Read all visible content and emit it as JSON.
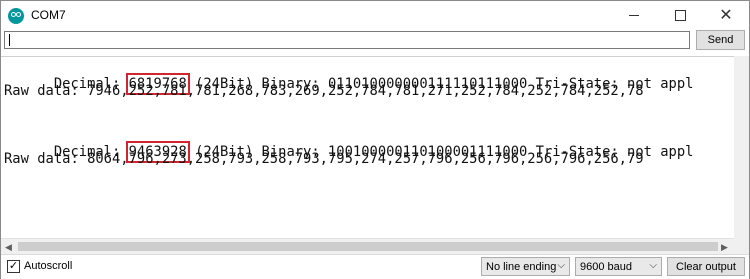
{
  "window": {
    "title": "COM7",
    "controls": {
      "minimize": "minimize",
      "maximize": "maximize",
      "close": "close"
    }
  },
  "input_row": {
    "value": "",
    "send_label": "Send"
  },
  "output": {
    "lines": [
      {
        "prefix": "Decimal: ",
        "highlight": "6819768",
        "rest": " (24Bit) Binary: 011010000000111110111000 Tri-State: not appl"
      },
      {
        "text": "Raw data: 7946,252,781,781,268,783,269,252,784,781,271,252,784,252,784,252,78"
      },
      {
        "text": ""
      },
      {
        "prefix": "Decimal: ",
        "highlight": "9463928",
        "rest": " (24Bit) Binary: 100100000110100001111000 Tri-State: not appl"
      },
      {
        "text": "Raw data: 8064,796,273,258,793,258,793,795,274,257,796,256,796,256,796,256,79"
      }
    ],
    "highlight_color": "#d0262d"
  },
  "bottom_bar": {
    "autoscroll_label": "Autoscroll",
    "autoscroll_checked": true,
    "line_ending": "No line ending",
    "baud": "9600 baud",
    "clear_label": "Clear output"
  },
  "colors": {
    "app_icon": "#00979c"
  },
  "icons": {
    "app": "arduino-logo-icon",
    "checkbox": "checkmark-icon",
    "dropdown": "chevron-down-icon"
  }
}
